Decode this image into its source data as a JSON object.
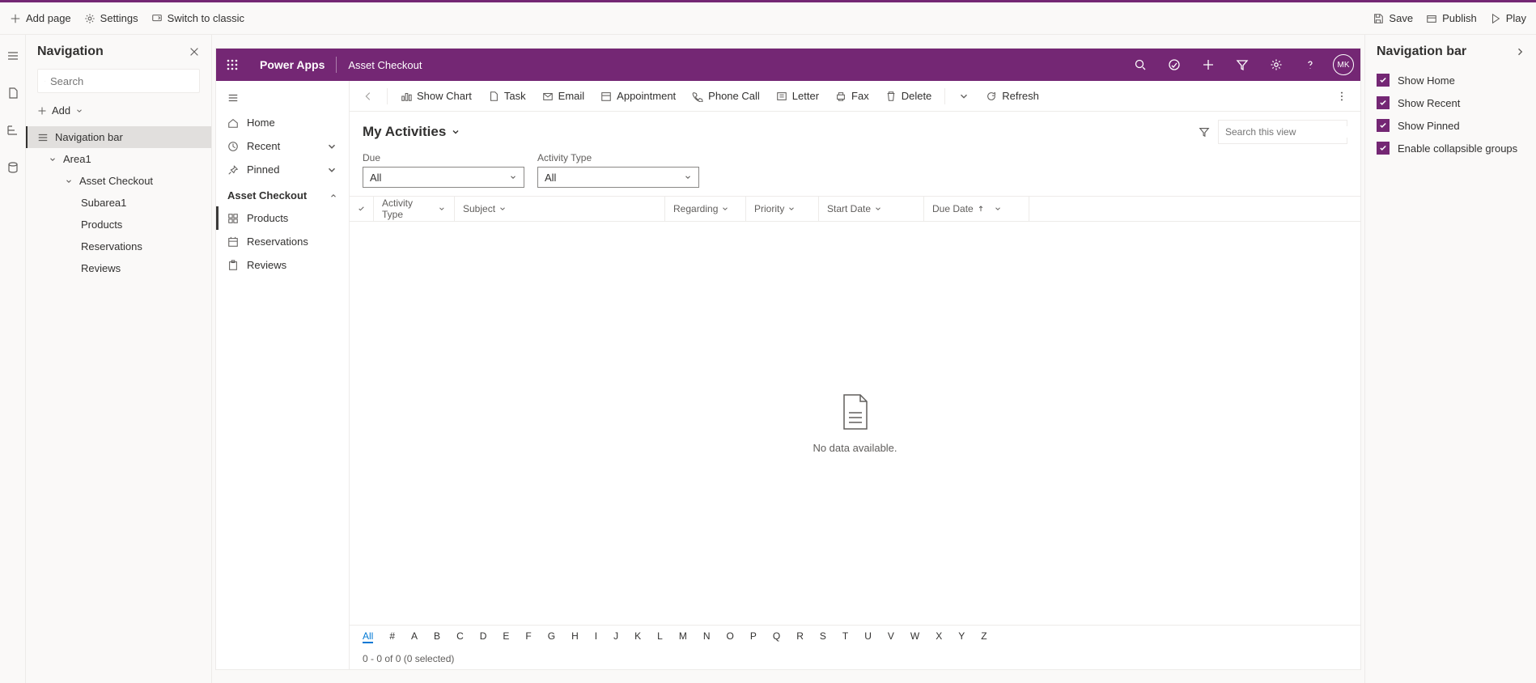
{
  "topbar": {
    "add_page": "Add page",
    "settings": "Settings",
    "switch_classic": "Switch to classic",
    "save": "Save",
    "publish": "Publish",
    "play": "Play"
  },
  "nav": {
    "title": "Navigation",
    "search_placeholder": "Search",
    "add": "Add",
    "items": {
      "navbar": "Navigation bar",
      "area1": "Area1",
      "asset_checkout": "Asset Checkout",
      "subarea1": "Subarea1",
      "products": "Products",
      "reservations": "Reservations",
      "reviews": "Reviews"
    }
  },
  "app": {
    "brand": "Power Apps",
    "name": "Asset Checkout",
    "avatar": "MK"
  },
  "sidebar": {
    "home": "Home",
    "recent": "Recent",
    "pinned": "Pinned",
    "group": "Asset Checkout",
    "products": "Products",
    "reservations": "Reservations",
    "reviews": "Reviews"
  },
  "cmd": {
    "show_chart": "Show Chart",
    "task": "Task",
    "email": "Email",
    "appointment": "Appointment",
    "phone_call": "Phone Call",
    "letter": "Letter",
    "fax": "Fax",
    "delete": "Delete",
    "refresh": "Refresh"
  },
  "view": {
    "title": "My Activities",
    "search_placeholder": "Search this view"
  },
  "filters": {
    "due_label": "Due",
    "due_value": "All",
    "type_label": "Activity Type",
    "type_value": "All"
  },
  "columns": {
    "activity_type": "Activity Type",
    "subject": "Subject",
    "regarding": "Regarding",
    "priority": "Priority",
    "start_date": "Start Date",
    "due_date": "Due Date"
  },
  "grid": {
    "empty": "No data available.",
    "status": "0 - 0 of 0 (0 selected)"
  },
  "alpha": [
    "All",
    "#",
    "A",
    "B",
    "C",
    "D",
    "E",
    "F",
    "G",
    "H",
    "I",
    "J",
    "K",
    "L",
    "M",
    "N",
    "O",
    "P",
    "Q",
    "R",
    "S",
    "T",
    "U",
    "V",
    "W",
    "X",
    "Y",
    "Z"
  ],
  "rp": {
    "title": "Navigation bar",
    "show_home": "Show Home",
    "show_recent": "Show Recent",
    "show_pinned": "Show Pinned",
    "collapsible": "Enable collapsible groups"
  }
}
